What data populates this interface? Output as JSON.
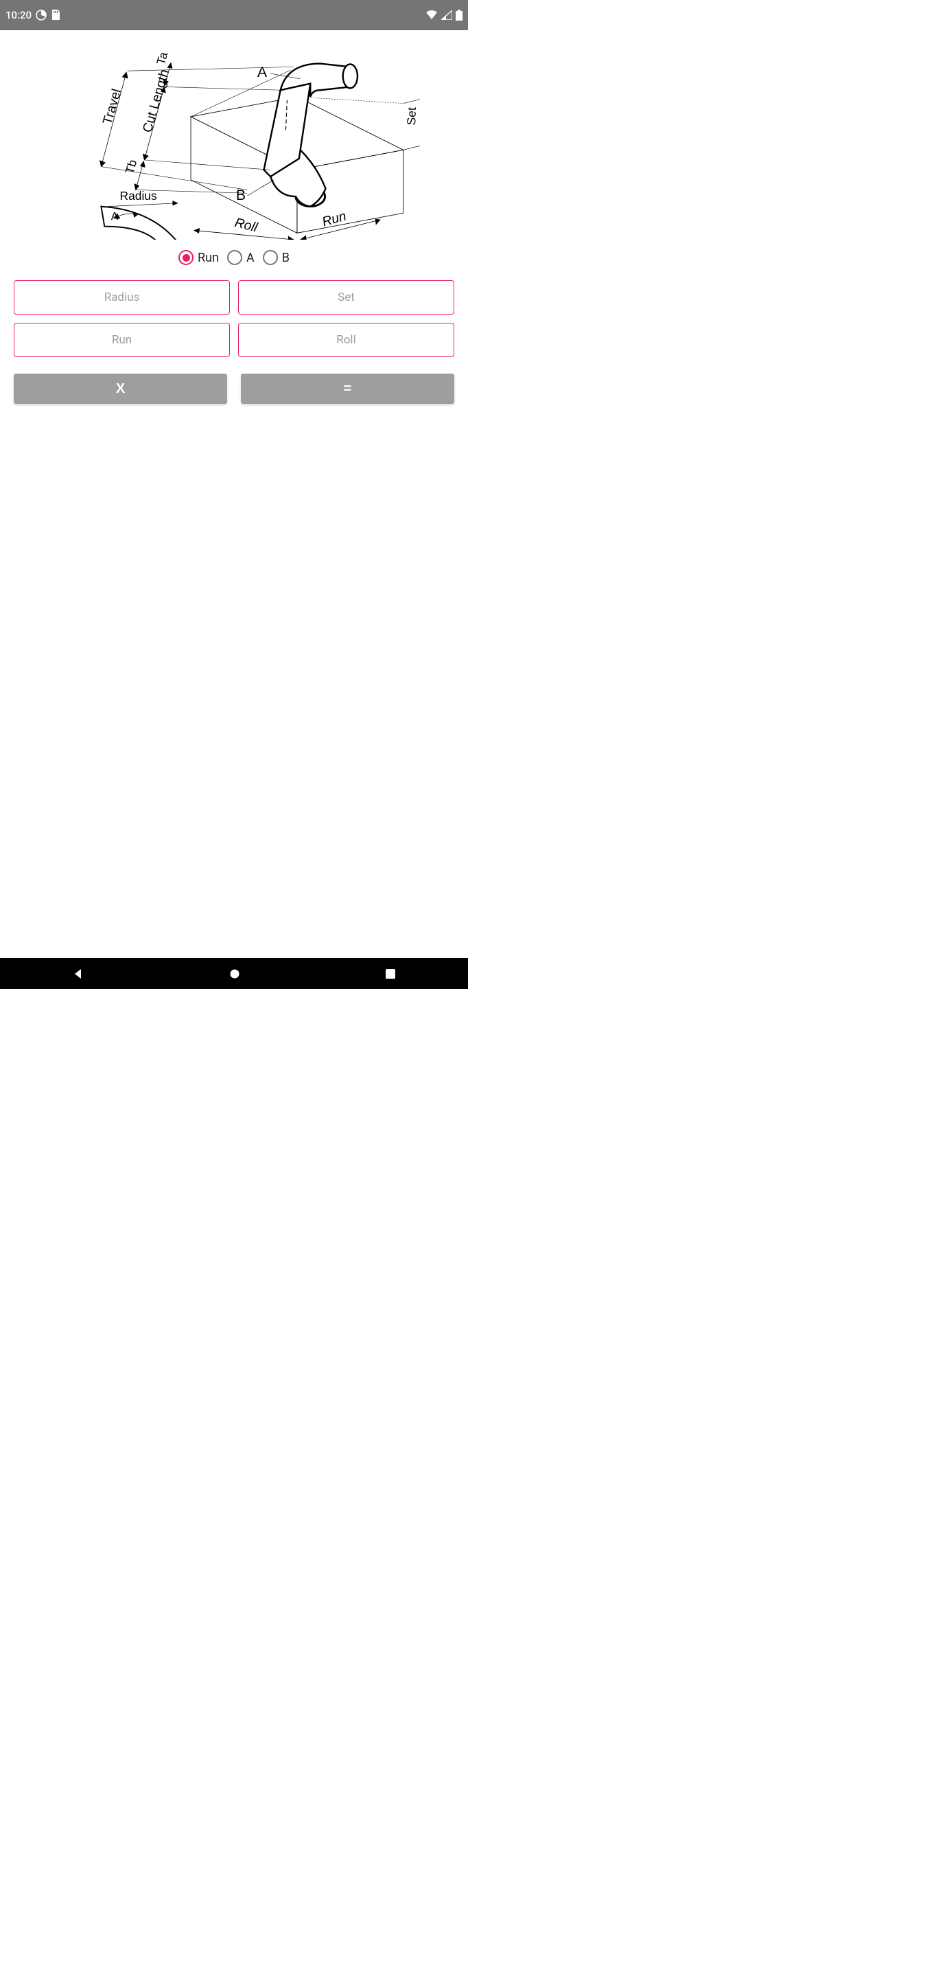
{
  "status": {
    "time": "10:20",
    "wifi_icon": "wifi-icon",
    "signal_icon": "signal-icon",
    "battery_icon": "battery-icon",
    "sd_icon": "sd-icon",
    "app_icon": "app-icon"
  },
  "diagram": {
    "labels": {
      "travel": "Travel",
      "cut_length": "Cut Length",
      "ta": "Ta",
      "tb": "Tb",
      "radius": "Radius",
      "a": "A",
      "b": "B",
      "roll": "Roll",
      "run": "Run",
      "set": "Set",
      "angle_a": "A"
    }
  },
  "radios": [
    {
      "label": "Run",
      "selected": true
    },
    {
      "label": "A",
      "selected": false
    },
    {
      "label": "B",
      "selected": false
    }
  ],
  "inputs": [
    {
      "placeholder": "Radius"
    },
    {
      "placeholder": "Set"
    },
    {
      "placeholder": "Run"
    },
    {
      "placeholder": "Roll"
    }
  ],
  "buttons": {
    "clear": "X",
    "calculate": "="
  },
  "colors": {
    "accent": "#e91e63",
    "status_bg": "#757575",
    "btn_bg": "#9e9e9e"
  }
}
